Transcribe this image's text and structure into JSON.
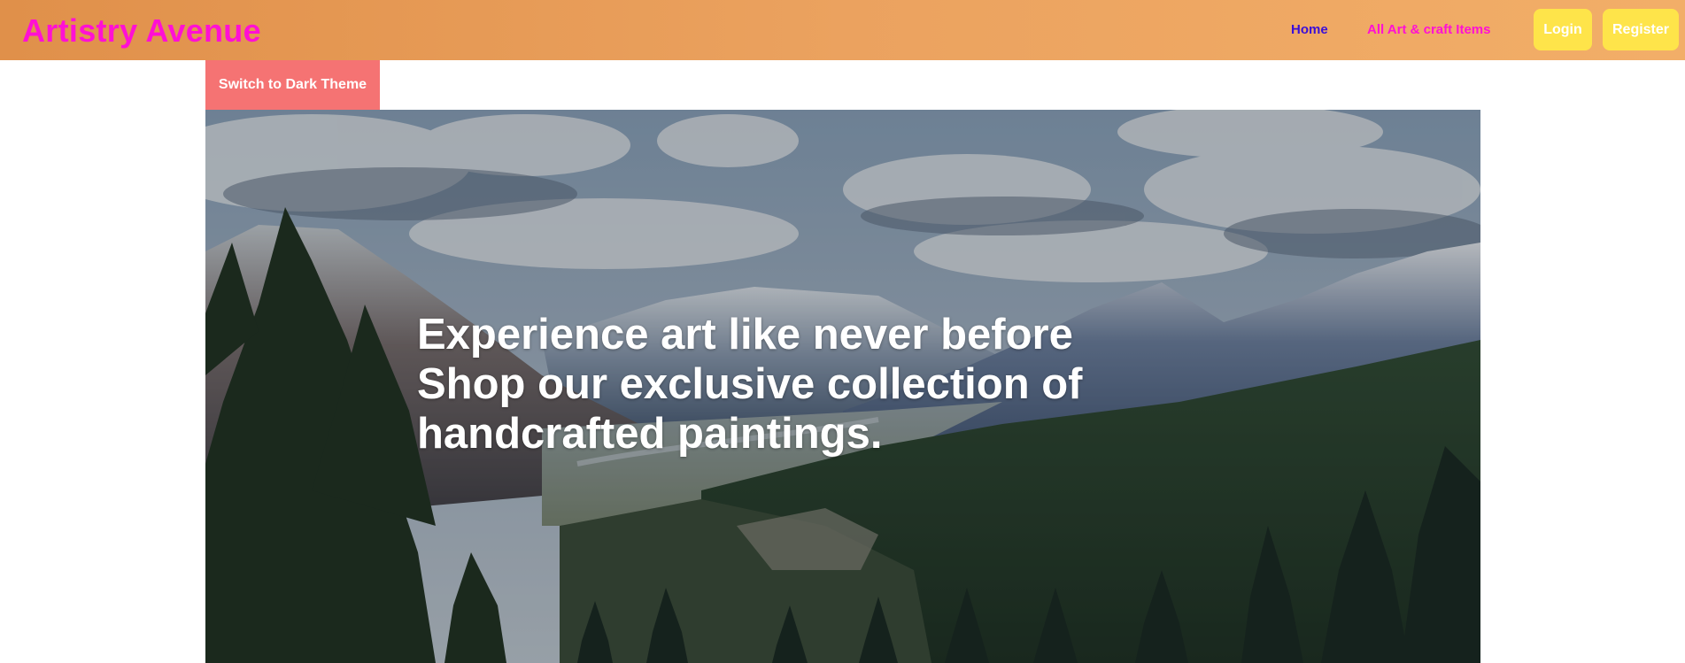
{
  "navbar": {
    "brand": "Artistry Avenue",
    "links": [
      {
        "label": "Home"
      },
      {
        "label": "All Art & craft Items"
      }
    ],
    "login_label": "Login",
    "register_label": "Register"
  },
  "theme_toggle": {
    "label": "Switch to Dark Theme"
  },
  "hero": {
    "headline": "Experience art like never before Shop our exclusive collection of handcrafted paintings."
  },
  "colors": {
    "brand": "#ff10d4",
    "home_link": "#3b0fd8",
    "auth_button": "#fee44a",
    "theme_button": "#f57373",
    "navbar_gradient_start": "#e0904a",
    "navbar_gradient_end": "#f2ae68"
  }
}
